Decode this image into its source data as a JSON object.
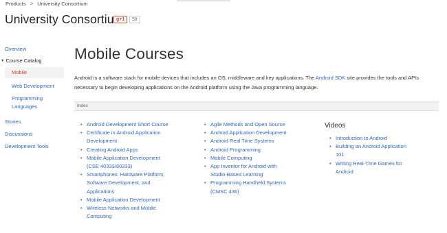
{
  "breadcrumb": {
    "items": [
      "Products",
      "University Consortium"
    ],
    "separator": ">"
  },
  "header": {
    "title": "University Consortium",
    "gplus_label": "g+1",
    "gplus_count": "59"
  },
  "sidebar": {
    "overview": "Overview",
    "catalog": "Course Catalog",
    "catalog_caret": "▼",
    "mobile": "Mobile",
    "web_development": "Web Development",
    "programming_languages_line1": "Programming",
    "programming_languages_line2": "Languages",
    "stories": "Stories",
    "discussions": "Discussions",
    "development_tools": "Development Tools"
  },
  "main": {
    "title": "Mobile Courses",
    "intro_part1": "Android is a software stack for mobile devices that includes an OS, middleware and key applications. The ",
    "intro_link": "Android SDK",
    "intro_part2": " site provides the tools and APIs necessary to begin developing applications on the Android platform using the Java programming language.",
    "index_label": "Index",
    "bullet": "•",
    "col1": [
      [
        "Android Development Short Course"
      ],
      [
        "Certificate in Android Application",
        "Development"
      ],
      [
        "Creating Android Apps"
      ],
      [
        "Mobile Application Development",
        "(CSE 40333/60333)"
      ],
      [
        "Smartphones: Hardware Platform,",
        "Software Development, and",
        "Applications"
      ],
      [
        "Mobile Application Development"
      ],
      [
        "Wireless Networks and Mobile",
        "Computing"
      ]
    ],
    "col2": [
      [
        "Agile Methods and Open Source"
      ],
      [
        "Android Application Development"
      ],
      [
        "Android Real Time Systems"
      ],
      [
        "Android Programming"
      ],
      [
        "Mobile Computing"
      ],
      [
        "App Inventor for Android with",
        "Studio-Based Learning"
      ],
      [
        "Programming Handheld Systems",
        "(CMSC 436)"
      ]
    ],
    "videos": {
      "heading": "Videos",
      "items": [
        [
          "Introduction to Android"
        ],
        [
          "Building an Android Application",
          "101"
        ],
        [
          "Writing Real-Time Games for",
          "Android"
        ]
      ]
    }
  },
  "colors": {
    "link": "#3366cc",
    "accent": "#d14836",
    "index_bg": "#f2f2f2"
  }
}
